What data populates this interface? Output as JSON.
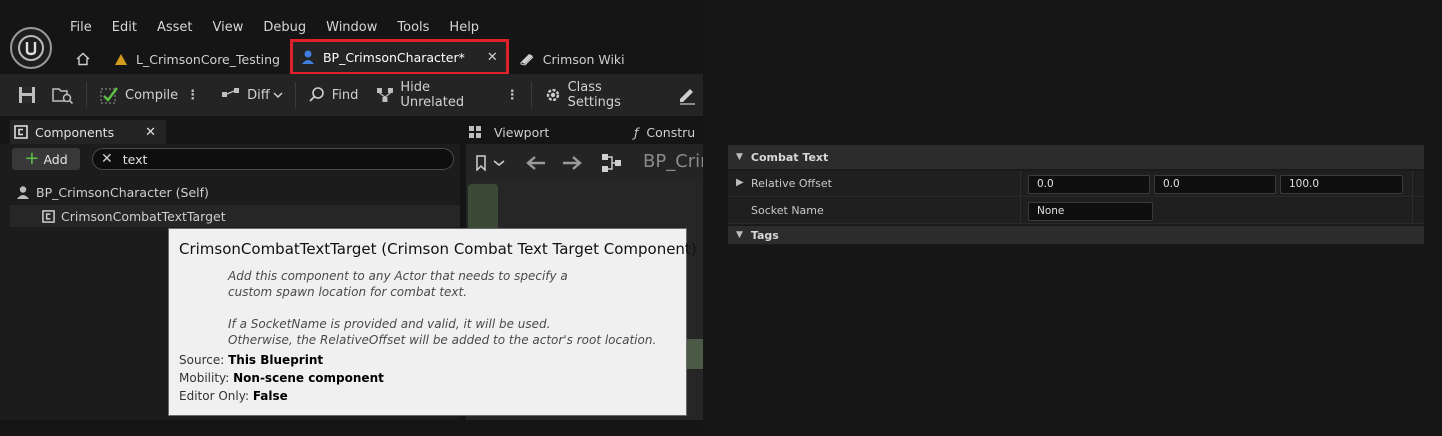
{
  "menu": [
    "File",
    "Edit",
    "Asset",
    "View",
    "Debug",
    "Window",
    "Tools",
    "Help"
  ],
  "tabs": {
    "level": "L_CrimsonCore_Testing",
    "blueprint": "BP_CrimsonCharacter*",
    "wiki": "Crimson Wiki"
  },
  "toolbar": {
    "compile": "Compile",
    "diff": "Diff",
    "find": "Find",
    "hide_unrelated": "Hide Unrelated",
    "class_settings": "Class Settings"
  },
  "components": {
    "title": "Components",
    "add": "Add",
    "search_value": "text",
    "self_label": "BP_CrimsonCharacter (Self)",
    "child_label": "CrimsonCombatTextTarget"
  },
  "viewport": {
    "tab": "Viewport",
    "construct_tab": "Constru",
    "title": "BP_Crim"
  },
  "tooltip": {
    "title": "CrimsonCombatTextTarget (Crimson Combat Text Target Component)",
    "desc": [
      "Add this component to any Actor that needs to specify a",
      "custom spawn location for combat text.",
      "",
      "If a SocketName is provided and valid, it will be used.",
      "Otherwise, the RelativeOffset will be added to the actor's root location."
    ],
    "source_label": "Source:",
    "source_value": "This Blueprint",
    "mobility_label": "Mobility:",
    "mobility_value": "Non-scene component",
    "editor_only_label": "Editor Only:",
    "editor_only_value": "False"
  },
  "details": {
    "category": "Combat Text",
    "relative_offset_label": "Relative Offset",
    "relative_offset": [
      "0.0",
      "0.0",
      "100.0"
    ],
    "socket_name_label": "Socket Name",
    "socket_name_value": "None",
    "tags_category": "Tags"
  },
  "colors": {
    "highlight": "#e0202a",
    "add_plus": "#5ec147"
  }
}
